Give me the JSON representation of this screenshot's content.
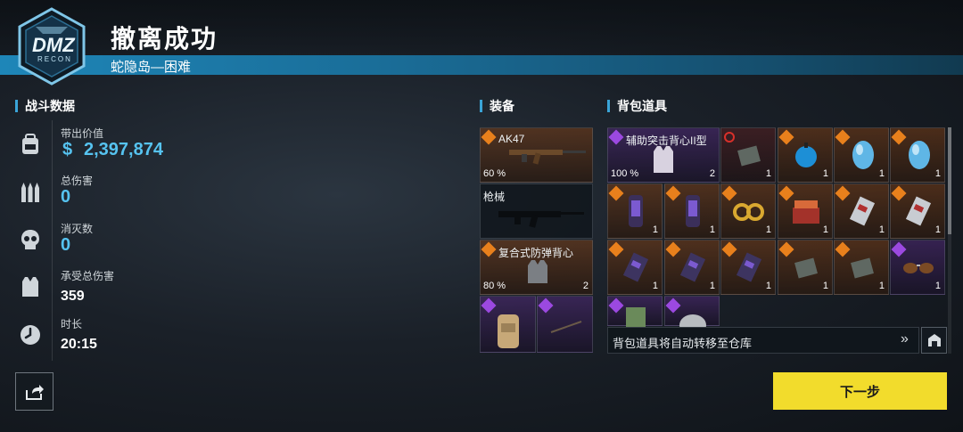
{
  "header": {
    "title": "撤离成功",
    "subtitle": "蛇隐岛—困难",
    "logo_text_main": "DMZ",
    "logo_text_sub": "RECON"
  },
  "stats": {
    "section_label": "战斗数据",
    "items": [
      {
        "label": "带出价值",
        "value": "2,397,874",
        "currency": "$",
        "icon": "backpack-icon"
      },
      {
        "label": "总伤害",
        "value": "0",
        "icon": "ammo-icon"
      },
      {
        "label": "消灭数",
        "value": "0",
        "icon": "skull-icon"
      },
      {
        "label": "承受总伤害",
        "value": "359",
        "icon": "armor-vest-icon"
      },
      {
        "label": "时长",
        "value": "20:15",
        "icon": "clock-icon"
      }
    ]
  },
  "equipment": {
    "section_label": "装备",
    "primary": {
      "name": "AK47",
      "durability": "60 %",
      "rarity": "orange"
    },
    "secondary": {
      "name": "枪械"
    },
    "vest": {
      "name": "复合式防弹背心",
      "durability": "80 %",
      "plates": "2",
      "rarity": "orange"
    },
    "extra1": {
      "rarity": "purple"
    },
    "extra2": {
      "rarity": "purple"
    }
  },
  "backpack": {
    "section_label": "背包道具",
    "first": {
      "name": "辅助突击背心II型",
      "durability": "100 %",
      "plates": "2",
      "rarity": "purple"
    },
    "row1": [
      {
        "rarity": "red",
        "count": "1",
        "icon": "documents-icon"
      },
      {
        "rarity": "orange",
        "count": "1",
        "icon": "blue-fruit-icon"
      },
      {
        "rarity": "orange",
        "count": "1",
        "icon": "blue-egg-icon"
      },
      {
        "rarity": "orange",
        "count": "1",
        "icon": "blue-egg-icon"
      }
    ],
    "row2": [
      {
        "rarity": "orange",
        "count": "1",
        "icon": "phone-icon"
      },
      {
        "rarity": "orange",
        "count": "1",
        "icon": "phone-icon"
      },
      {
        "rarity": "orange",
        "count": "1",
        "icon": "gold-rings-icon"
      },
      {
        "rarity": "orange",
        "count": "1",
        "icon": "jewel-box-icon"
      },
      {
        "rarity": "orange",
        "count": "1",
        "icon": "keycard-icon"
      },
      {
        "rarity": "orange",
        "count": "1",
        "icon": "keycard-icon"
      }
    ],
    "row3": [
      {
        "rarity": "orange",
        "count": "1",
        "icon": "keycard-icon"
      },
      {
        "rarity": "orange",
        "count": "1",
        "icon": "keycard-icon"
      },
      {
        "rarity": "orange",
        "count": "1",
        "icon": "keycard-icon"
      },
      {
        "rarity": "orange",
        "count": "1",
        "icon": "documents-icon"
      },
      {
        "rarity": "orange",
        "count": "1",
        "icon": "documents-icon"
      },
      {
        "rarity": "purple",
        "count": "1",
        "icon": "sunglasses-icon"
      }
    ],
    "row4": [
      {
        "rarity": "purple",
        "icon": "map-icon"
      },
      {
        "rarity": "purple",
        "icon": "coin-icon"
      }
    ],
    "transfer_text": "背包道具将自动转移至仓库"
  },
  "actions": {
    "next_label": "下一步"
  },
  "colors": {
    "accent_blue": "#3aa4d8",
    "rarity_orange": "#e8801c",
    "rarity_purple": "#9b49e0",
    "next_button": "#f2dc2c"
  }
}
